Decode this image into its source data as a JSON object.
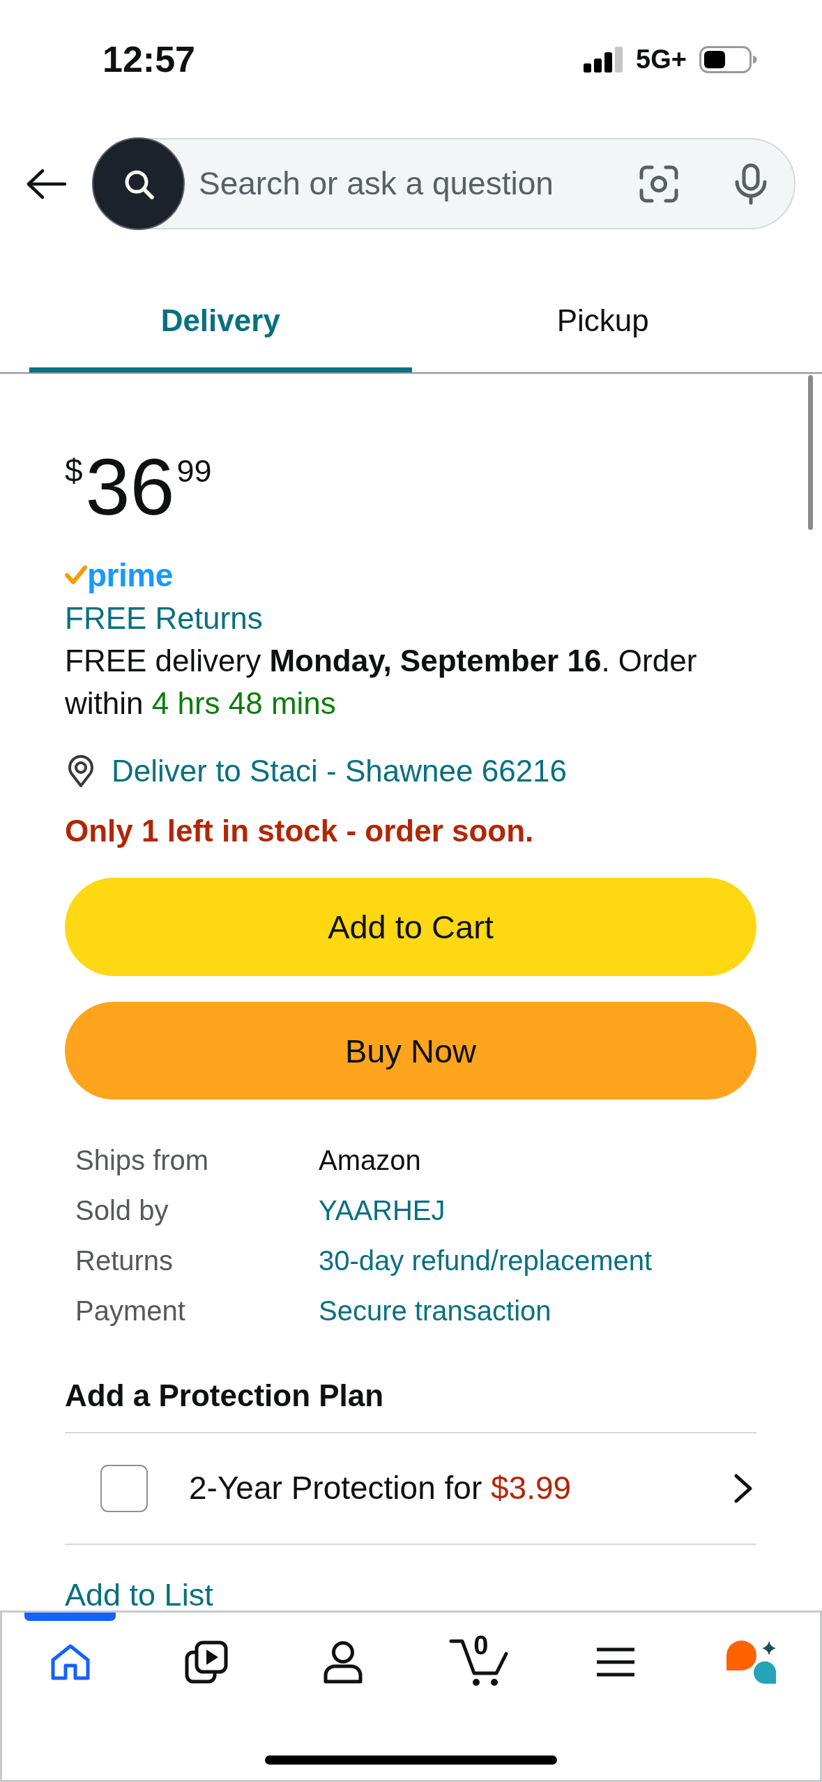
{
  "status_bar": {
    "time": "12:57",
    "network": "5G+"
  },
  "search": {
    "placeholder": "Search or ask a question"
  },
  "tabs": [
    {
      "label": "Delivery",
      "selected": true
    },
    {
      "label": "Pickup",
      "selected": false
    }
  ],
  "price": {
    "currency": "$",
    "whole": "36",
    "fraction": "99"
  },
  "prime": {
    "label": "prime"
  },
  "free_returns": "FREE Returns",
  "delivery": {
    "text": "FREE delivery **Monday, September 16**. Order within",
    "countdown": "4 hrs 48 mins"
  },
  "deliver_to": "Deliver to Staci - Shawnee 66216",
  "stock": "Only 1 left in stock - order soon.",
  "buttons": [
    {
      "label": "Add to Cart",
      "kind": "cart"
    },
    {
      "label": "Buy Now",
      "kind": "buy"
    }
  ],
  "details": [
    {
      "label": "Ships from",
      "value": "Amazon",
      "link": false
    },
    {
      "label": "Sold by",
      "value": "YAARHEJ",
      "link": true
    },
    {
      "label": "Returns",
      "value": "30-day refund/replacement",
      "link": true
    },
    {
      "label": "Payment",
      "value": "Secure transaction",
      "link": true
    }
  ],
  "protection": {
    "title": "Add a Protection Plan",
    "options": [
      {
        "text": "2-Year Protection for",
        "price": "$3.99",
        "checked": false
      }
    ]
  },
  "add_to_list": "Add to List",
  "bottom_nav": [
    {
      "kind": "home",
      "selected": true
    },
    {
      "kind": "video",
      "selected": false
    },
    {
      "kind": "account",
      "selected": false
    },
    {
      "kind": "cart",
      "count": "0",
      "selected": false
    },
    {
      "kind": "menu",
      "selected": false
    },
    {
      "kind": "assistant",
      "selected": false
    }
  ]
}
